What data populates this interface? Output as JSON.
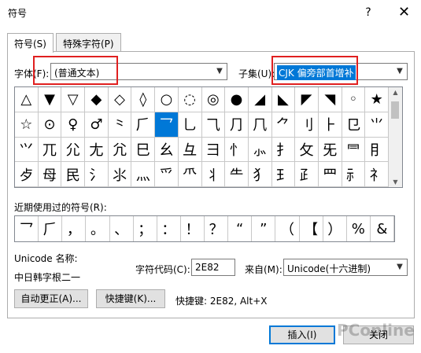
{
  "window": {
    "title": "符号",
    "help": "?",
    "close": "✕"
  },
  "tabs": [
    {
      "label": "符号(S)"
    },
    {
      "label": "特殊字符(P)"
    }
  ],
  "font": {
    "label": "字体(F):",
    "value": "(普通文本)"
  },
  "subset": {
    "label": "子集(U):",
    "value": "CJK 偏旁部首增补"
  },
  "symbols": [
    [
      "△",
      "▼",
      "▽",
      "◆",
      "◇",
      "◊",
      "○",
      "◌",
      "◎",
      "●",
      "◢",
      "◣",
      "◤",
      "◥",
      "◦",
      "★"
    ],
    [
      "☆",
      "⊙",
      "♀",
      "♂",
      "⺀",
      "⺁",
      "⺂",
      "⺃",
      "⺄",
      "⺆",
      "⺇",
      "⺈",
      "⺉",
      "⺊",
      "⺋",
      "⺌"
    ],
    [
      "⺍",
      "⺎",
      "⺏",
      "⺐",
      "⺑",
      "⺒",
      "⺓",
      "⺔",
      "⺕",
      "⺖",
      "⺗",
      "⺘",
      "⺙",
      "⺛",
      "⺜",
      "⺝"
    ],
    [
      "⺞",
      "⺟",
      "⺠",
      "⺡",
      "⺢",
      "⺣",
      "⺤",
      "⺥",
      "⺦",
      "⺧",
      "⺨",
      "⺩",
      "⺪",
      "⺫",
      "⺬",
      "⺭"
    ]
  ],
  "selected_symbol": {
    "row": 1,
    "col": 6
  },
  "recent": {
    "label": "近期使用过的符号(R):",
    "items": [
      "⺂",
      "⺁",
      "，",
      "。",
      "、",
      "；",
      "：",
      "！",
      "？",
      "“",
      "”",
      "（",
      "【",
      "）",
      "%",
      "&"
    ]
  },
  "unicode_name": {
    "label": "Unicode 名称:",
    "value": "中日韩字根二一"
  },
  "char_code": {
    "label": "字符代码(C):",
    "value": "2E82"
  },
  "from": {
    "label": "来自(M):",
    "value": "Unicode(十六进制)"
  },
  "buttons": {
    "autocorrect": "自动更正(A)...",
    "shortcut_key": "快捷键(K)...",
    "insert": "插入(I)",
    "close": "关闭"
  },
  "shortcut_text": "快捷键: 2E82, Alt+X",
  "watermark": "PConline",
  "colors": {
    "highlight": "#0078d7",
    "annotation_box": "#e02020"
  }
}
